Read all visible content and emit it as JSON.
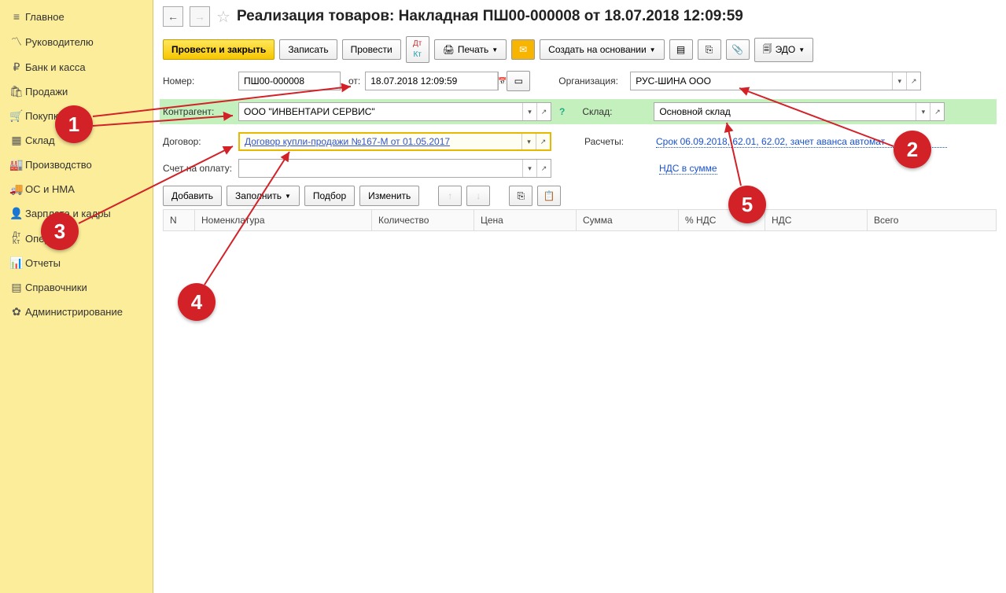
{
  "sidebar": {
    "items": [
      {
        "label": "Главное"
      },
      {
        "label": "Руководителю"
      },
      {
        "label": "Банк и касса"
      },
      {
        "label": "Продажи"
      },
      {
        "label": "Покупки"
      },
      {
        "label": "Склад"
      },
      {
        "label": "Производство"
      },
      {
        "label": "ОС и НМА"
      },
      {
        "label": "Зарплата и кадры"
      },
      {
        "label": "Операции"
      },
      {
        "label": "Отчеты"
      },
      {
        "label": "Справочники"
      },
      {
        "label": "Администрирование"
      }
    ]
  },
  "title": "Реализация товаров: Накладная ПШ00-000008 от 18.07.2018 12:09:59",
  "toolbar": {
    "post_close": "Провести и закрыть",
    "save": "Записать",
    "post": "Провести",
    "print": "Печать",
    "create_based": "Создать на основании",
    "edo": "ЭДО"
  },
  "form": {
    "number_label": "Номер:",
    "number_value": "ПШ00-000008",
    "from_label": "от:",
    "date_value": "18.07.2018 12:09:59",
    "org_label": "Организация:",
    "org_value": "РУС-ШИНА ООО",
    "counterparty_label": "Контрагент:",
    "counterparty_value": "ООО \"ИНВЕНТАРИ СЕРВИС\"",
    "warehouse_label": "Склад:",
    "warehouse_value": "Основной склад",
    "contract_label": "Договор:",
    "contract_value": "Договор купли-продажи №167-М от 01.05.2017",
    "calc_label": "Расчеты:",
    "calc_link": "Срок 06.09.2018, 62.01, 62.02, зачет аванса автомат",
    "invoice_label": "Счет на оплату:",
    "invoice_value": "",
    "vat_link": "НДС в сумме"
  },
  "table_toolbar": {
    "add": "Добавить",
    "fill": "Заполнить",
    "pick": "Подбор",
    "change": "Изменить"
  },
  "table": {
    "columns": [
      "N",
      "Номенклатура",
      "Количество",
      "Цена",
      "Сумма",
      "% НДС",
      "НДС",
      "Всего"
    ]
  },
  "markers": {
    "m1": "1",
    "m2": "2",
    "m3": "3",
    "m4": "4",
    "m5": "5"
  }
}
